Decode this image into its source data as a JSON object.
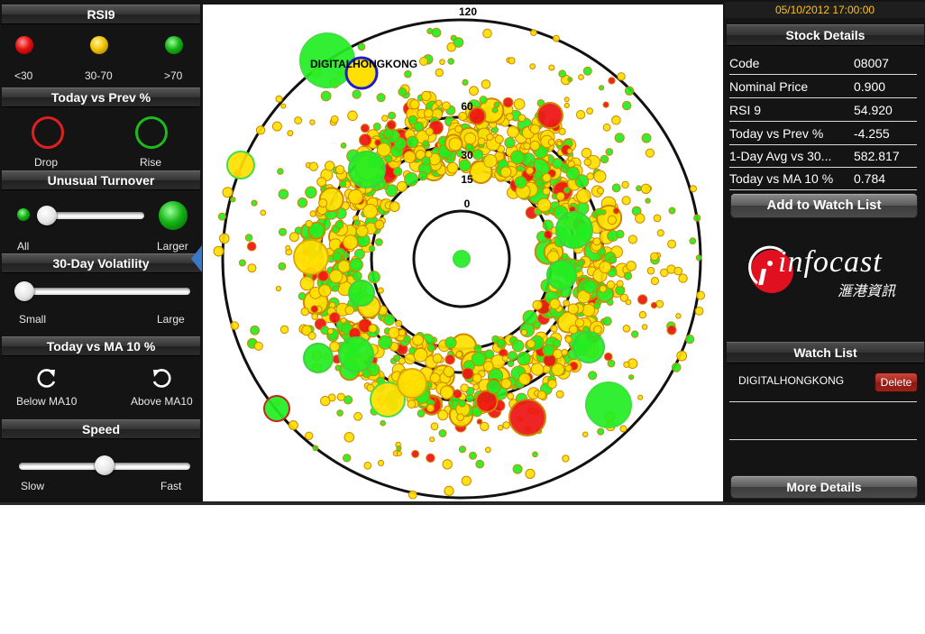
{
  "left_panel": {
    "rsi": {
      "title": "RSI9",
      "labels": [
        "<30",
        "30-70",
        ">70"
      ]
    },
    "today_vs_prev": {
      "title": "Today vs Prev %",
      "drop": "Drop",
      "rise": "Rise"
    },
    "unusual_turnover": {
      "title": "Unusual Turnover",
      "min_label": "All",
      "max_label": "Larger",
      "value": 0.0
    },
    "volatility": {
      "title": "30-Day Volatility",
      "min_label": "Small",
      "max_label": "Large",
      "value": 0.0
    },
    "ma10": {
      "title": "Today vs MA 10 %",
      "below": "Below MA10",
      "above": "Above MA10"
    },
    "speed": {
      "title": "Speed",
      "min_label": "Slow",
      "max_label": "Fast",
      "value": 0.5
    }
  },
  "radar": {
    "ring_labels": [
      "120",
      "60",
      "30",
      "15",
      "0"
    ],
    "highlight_label": "DIGITALHONGKONG",
    "colors": {
      "red": "#ee1111",
      "yellow": "#ffe000",
      "green": "#22ee22",
      "highlight": "#1d1dcc"
    }
  },
  "right_panel": {
    "datetime": "05/10/2012 17:00:00",
    "stock_details_title": "Stock Details",
    "details": [
      {
        "key": "Code",
        "value": "08007"
      },
      {
        "key": "Nominal Price",
        "value": "0.900"
      },
      {
        "key": "RSI 9",
        "value": "54.920"
      },
      {
        "key": "Today vs Prev %",
        "value": "-4.255"
      },
      {
        "key": "1-Day Avg vs 30...",
        "value": "582.817"
      },
      {
        "key": "Today vs MA 10 %",
        "value": "0.784"
      }
    ],
    "add_button": "Add to Watch List",
    "logo_text": "infocast",
    "logo_chinese": "滙港資訊",
    "watch_list_title": "Watch List",
    "watch_items": [
      {
        "name": "DIGITALHONGKONG",
        "delete_label": "Delete"
      }
    ],
    "more_button": "More Details"
  }
}
